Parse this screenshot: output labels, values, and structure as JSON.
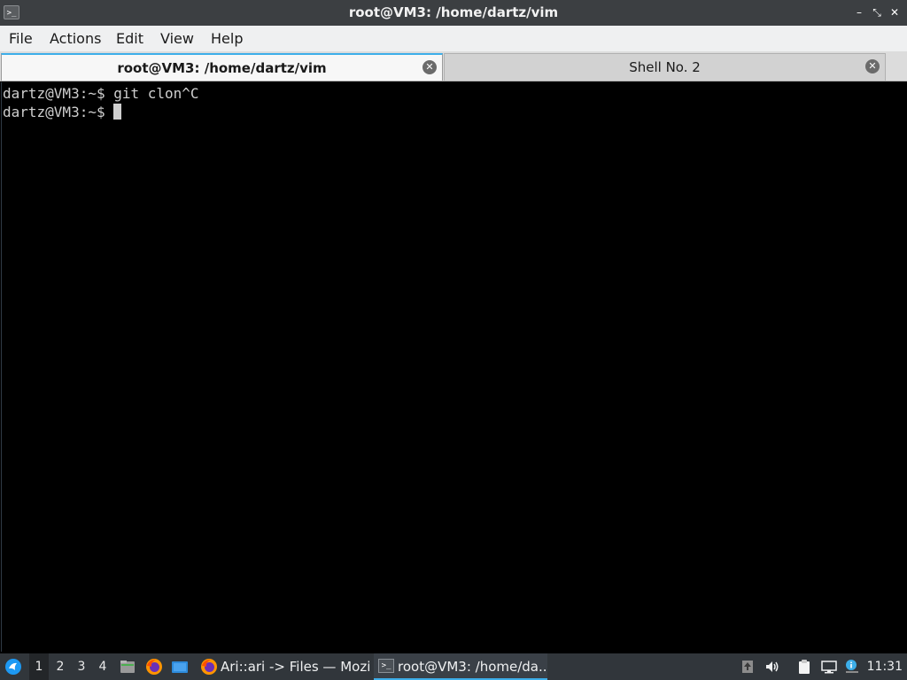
{
  "window": {
    "title": "root@VM3: /home/dartz/vim",
    "app_icon_glyph": ">_",
    "buttons": {
      "minimize": "–",
      "restore": "⤡",
      "close": "✕"
    }
  },
  "menubar": {
    "items": [
      "File",
      "Actions",
      "Edit",
      "View",
      "Help"
    ]
  },
  "tabs": [
    {
      "label": "root@VM3: /home/dartz/vim",
      "active": true
    },
    {
      "label": "Shell No. 2",
      "active": false
    }
  ],
  "terminal": {
    "lines": [
      "dartz@VM3:~$ git clon^C",
      "dartz@VM3:~$ "
    ],
    "colors": {
      "background": "#000000",
      "foreground": "#cfcfcf"
    }
  },
  "taskbar": {
    "desktops": [
      "1",
      "2",
      "3",
      "4"
    ],
    "active_desktop": "1",
    "launchers": [
      "start-menu-icon",
      "file-manager-icon",
      "firefox-icon",
      "show-desktop-icon"
    ],
    "tasks": [
      {
        "label": "Ari::ari -> Files — Mozi...",
        "icon": "firefox-icon",
        "active": false
      },
      {
        "label": "root@VM3: /home/da...",
        "icon": "terminal-icon",
        "active": true
      }
    ],
    "tray": [
      "update-notifier-icon",
      "volume-icon",
      "clipboard-icon",
      "network-icon",
      "info-icon"
    ],
    "clock": "11:31"
  },
  "accent_color": "#3daee9"
}
